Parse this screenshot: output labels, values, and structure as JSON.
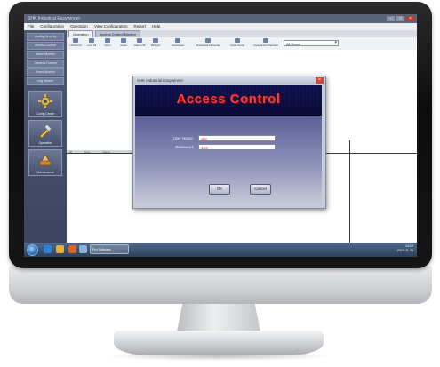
{
  "window": {
    "title": "SHK Industrial Easywinner",
    "menu": [
      "File",
      "Configuration",
      "Operation",
      "View Configuration",
      "Report",
      "Help"
    ]
  },
  "sidebar": {
    "buttons": [
      "Config Security",
      "Access Control",
      "Alarm Monitor",
      "Camera Control",
      "Event Monitor",
      "Log Viewer"
    ],
    "tiles": [
      {
        "label": "Config Center",
        "icon": "gear-icon"
      },
      {
        "label": "Operation",
        "icon": "tools-icon"
      },
      {
        "label": "Maintenance",
        "icon": "wrench-icon"
      }
    ]
  },
  "tabs": [
    {
      "label": "Operation",
      "active": true
    },
    {
      "label": "Access Control Monitor",
      "active": false
    }
  ],
  "toolbar": {
    "items": [
      "Unlock All",
      "Lock All",
      "Open",
      "Close",
      "Alarm Off",
      "Refresh",
      "Download",
      "Download All Cards",
      "Clear Cards",
      "Clear Event Records"
    ],
    "select_value": "All Doors"
  },
  "workspace": {
    "strip_cols": [
      "ID",
      "Door",
      "Status"
    ]
  },
  "taskbar": {
    "task_label": "Pro Software",
    "tray_time": "14:22",
    "tray_date": "2019-11-26"
  },
  "dialog": {
    "title": "SHK Industrial Easywinner",
    "banner": "Access Control",
    "user_label": "User Name:",
    "user_value": "abc",
    "password_label": "Password:",
    "password_value": "123",
    "ok_label": "OK",
    "cancel_label": "Cancel"
  },
  "colors": {
    "accent": "#ff3c32",
    "banner_bg": "#3d3f86",
    "sidebar_bg": "#4d5a76",
    "taskbar_bg": "#2c3f5a"
  }
}
